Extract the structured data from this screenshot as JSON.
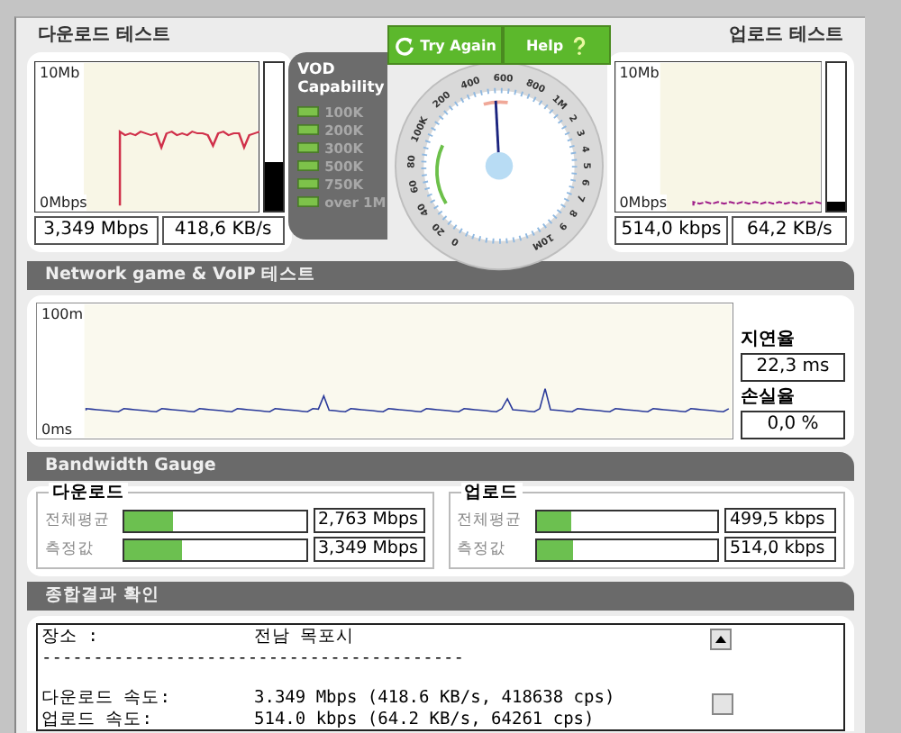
{
  "download_test": {
    "title": "다운로드 테스트",
    "axis_top": "10Mb",
    "axis_bottom": "0Mbps",
    "meter": {
      "level": 0.33
    },
    "readouts": [
      "3,349 Mbps",
      "418,6 KB/s"
    ]
  },
  "vod_capability": {
    "title": "VOD Capability",
    "items": [
      "100K",
      "200K",
      "300K",
      "500K",
      "750K",
      "over 1M"
    ]
  },
  "gauge": {
    "buttons": [
      {
        "label": "Try Again",
        "kind": "retry"
      },
      {
        "label": "Help",
        "kind": "help"
      }
    ],
    "scale_labels": [
      "0",
      "20",
      "40",
      "60",
      "80",
      "100K",
      "200",
      "400",
      "600",
      "800",
      "1M",
      "2",
      "3",
      "4",
      "5",
      "6",
      "7",
      "8",
      "9",
      "10M"
    ]
  },
  "upload_test": {
    "title": "업로드 테스트",
    "axis_top": "10Mb",
    "axis_bottom": "0Mbps",
    "meter": {
      "level": 0.06
    },
    "readouts": [
      "514,0 kbps",
      "64,2 KB/s"
    ]
  },
  "voip_test": {
    "title": "Network game & VoIP 테스트",
    "axis_top": "100m",
    "axis_bottom": "0ms",
    "latency_label": "지연율",
    "latency": "22,3 ms",
    "loss_label": "손실율",
    "loss": "0,0 %"
  },
  "bandwidth_gauge": {
    "title": "Bandwidth Gauge",
    "groups": [
      {
        "title": "다운로드",
        "rows": [
          {
            "label": "전체평균",
            "level": 0.27,
            "value": "2,763 Mbps"
          },
          {
            "label": "측정값",
            "level": 0.32,
            "value": "3,349 Mbps"
          }
        ]
      },
      {
        "title": "업로드",
        "rows": [
          {
            "label": "전체평균",
            "level": 0.19,
            "value": "499,5 kbps"
          },
          {
            "label": "측정값",
            "level": 0.2,
            "value": "514,0 kbps"
          }
        ]
      }
    ]
  },
  "summary": {
    "title": "종합결과 확인",
    "lines": [
      {
        "kind": "field",
        "label": "장소 :",
        "value": "전남 목포시"
      },
      {
        "kind": "rule",
        "text": "-----------------------------------------"
      },
      {
        "kind": "field",
        "label": "다운로드 속도:",
        "value": "3.349 Mbps (418.6 KB/s, 418638 cps)"
      },
      {
        "kind": "field",
        "label": "업로드 속도:",
        "value": "514.0 kbps (64.2 KB/s, 64261 cps)"
      }
    ]
  }
}
